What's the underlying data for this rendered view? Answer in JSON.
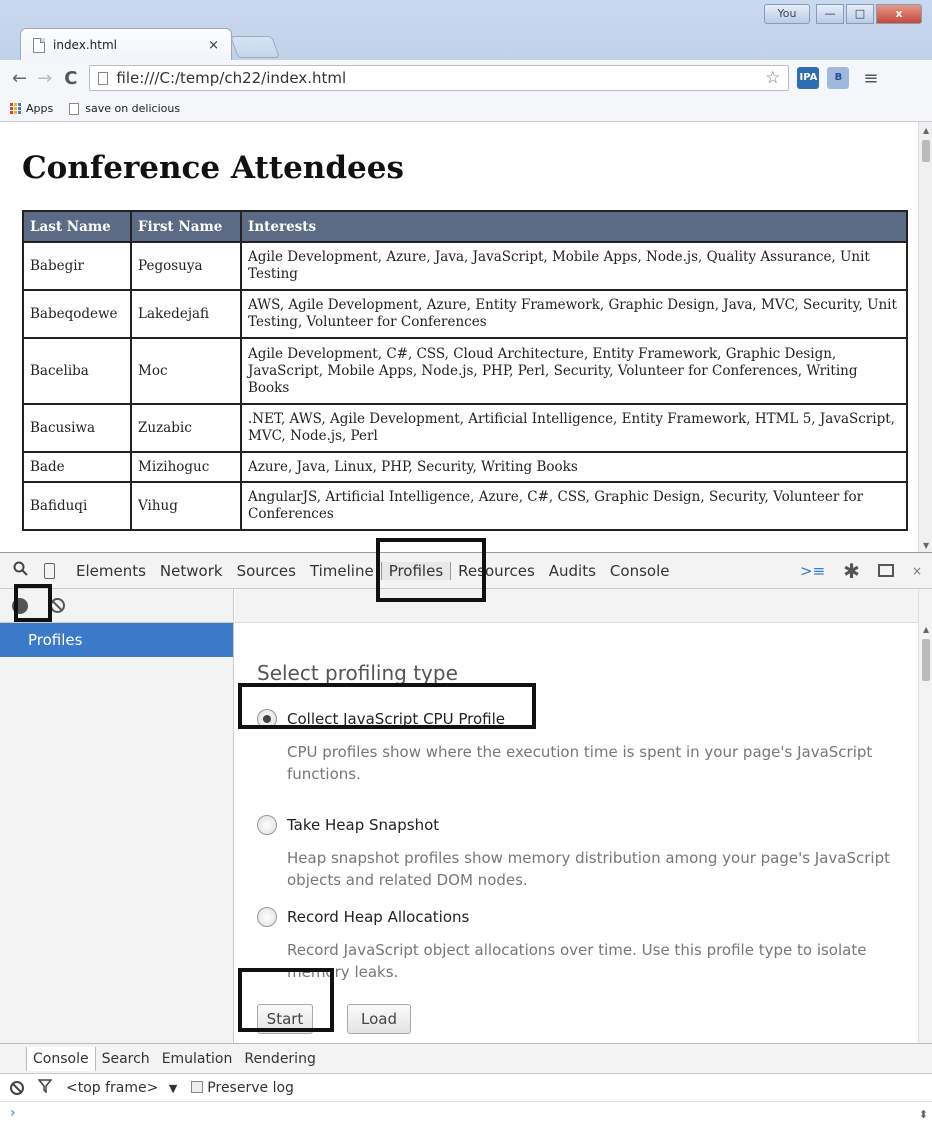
{
  "browser": {
    "tab_title": "index.html",
    "tab_close": "×",
    "user_label": "You",
    "window_controls": {
      "minimize": "—",
      "maximize": "□",
      "close": "x"
    },
    "url": "file:///C:/temp/ch22/index.html",
    "back_icon": "←",
    "forward_icon": "→",
    "reload_icon": "C",
    "star_icon": "☆",
    "menu_icon": "≡",
    "extensions": [
      "IPA",
      "B"
    ],
    "bookmarks": [
      {
        "label": "Apps"
      },
      {
        "label": "save on delicious"
      }
    ]
  },
  "page": {
    "title": "Conference Attendees",
    "columns": [
      "Last Name",
      "First Name",
      "Interests"
    ],
    "rows": [
      {
        "last": "Babegir",
        "first": "Pegosuya",
        "interests": "Agile Development, Azure, Java, JavaScript, Mobile Apps, Node.js, Quality Assurance, Unit Testing"
      },
      {
        "last": "Babeqodewe",
        "first": "Lakedejafi",
        "interests": "AWS, Agile Development, Azure, Entity Framework, Graphic Design, Java, MVC, Security, Unit Testing, Volunteer for Conferences"
      },
      {
        "last": "Baceliba",
        "first": "Moc",
        "interests": "Agile Development, C#, CSS, Cloud Architecture, Entity Framework, Graphic Design, JavaScript, Mobile Apps, Node.js, PHP, Perl, Security, Volunteer for Conferences, Writing Books"
      },
      {
        "last": "Bacusiwa",
        "first": "Zuzabic",
        "interests": ".NET, AWS, Agile Development, Artificial Intelligence, Entity Framework, HTML 5, JavaScript, MVC, Node.js, Perl"
      },
      {
        "last": "Bade",
        "first": "Mizihoguc",
        "interests": "Azure, Java, Linux, PHP, Security, Writing Books"
      },
      {
        "last": "Bafiduqi",
        "first": "Vihug",
        "interests": "AngularJS, Artificial Intelligence, Azure, C#, CSS, Graphic Design, Security, Volunteer for Conferences"
      }
    ]
  },
  "devtools": {
    "tabs": [
      "Elements",
      "Network",
      "Sources",
      "Timeline",
      "Profiles",
      "Resources",
      "Audits",
      "Console"
    ],
    "selected_tab": "Profiles",
    "close_icon": "×",
    "sidebar": {
      "profiles_label": "Profiles"
    },
    "heading": "Select profiling type",
    "profile_types": [
      {
        "label": "Collect JavaScript CPU Profile",
        "description": "CPU profiles show where the execution time is spent in your page's JavaScript functions.",
        "selected": true
      },
      {
        "label": "Take Heap Snapshot",
        "description": "Heap snapshot profiles show memory distribution among your page's JavaScript objects and related DOM nodes.",
        "selected": false
      },
      {
        "label": "Record Heap Allocations",
        "description": "Record JavaScript object allocations over time. Use this profile type to isolate memory leaks.",
        "selected": false
      }
    ],
    "start_label": "Start",
    "load_label": "Load",
    "drawer_tabs": [
      "Console",
      "Search",
      "Emulation",
      "Rendering"
    ],
    "frame_select": "<top frame>",
    "frame_arrow": "▼",
    "preserve_log": "Preserve log",
    "prompt": "›"
  },
  "colors": {
    "table_header": "#5b6b85",
    "selected_sidebar": "#3b79c9",
    "annotation_border": "#111111"
  }
}
